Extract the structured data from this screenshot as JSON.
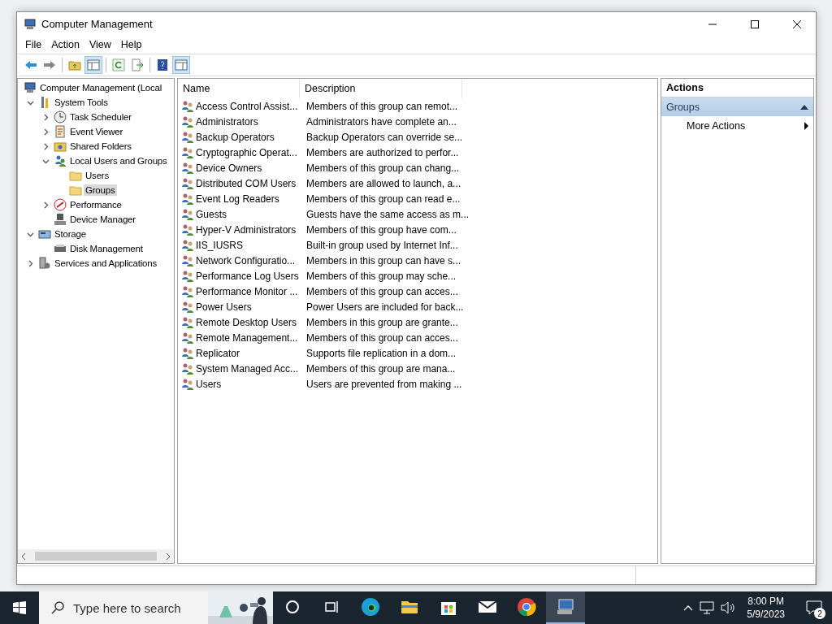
{
  "window": {
    "title": "Computer Management"
  },
  "menu": [
    {
      "label": "File"
    },
    {
      "label": "Action"
    },
    {
      "label": "View"
    },
    {
      "label": "Help"
    }
  ],
  "toolbar": [
    {
      "kind": "back",
      "pressed": false
    },
    {
      "kind": "forward",
      "pressed": false
    },
    {
      "kind": "sep"
    },
    {
      "kind": "up",
      "pressed": false
    },
    {
      "kind": "tree",
      "pressed": true
    },
    {
      "kind": "sep"
    },
    {
      "kind": "refresh",
      "pressed": false
    },
    {
      "kind": "export",
      "pressed": false
    },
    {
      "kind": "sep"
    },
    {
      "kind": "help",
      "pressed": false
    },
    {
      "kind": "actionpane",
      "pressed": true
    }
  ],
  "tree": {
    "label": "Computer Management (Local",
    "kind": "computer",
    "selected": false,
    "children": [
      {
        "label": "System Tools",
        "kind": "tools",
        "selected": false,
        "expanded": true,
        "children": [
          {
            "label": "Task Scheduler",
            "kind": "clock",
            "selected": false,
            "expanded": false
          },
          {
            "label": "Event Viewer",
            "kind": "viewer",
            "selected": false,
            "expanded": false
          },
          {
            "label": "Shared Folders",
            "kind": "share",
            "selected": false,
            "expanded": false
          },
          {
            "label": "Local Users and Groups",
            "kind": "users",
            "selected": false,
            "expanded": true,
            "children": [
              {
                "label": "Users",
                "kind": "folder",
                "selected": false
              },
              {
                "label": "Groups",
                "kind": "folder",
                "selected": true
              }
            ]
          },
          {
            "label": "Performance",
            "kind": "gauge",
            "selected": false,
            "expanded": false
          },
          {
            "label": "Device Manager",
            "kind": "device",
            "selected": false
          }
        ]
      },
      {
        "label": "Storage",
        "kind": "storage",
        "selected": false,
        "expanded": true,
        "children": [
          {
            "label": "Disk Management",
            "kind": "disk",
            "selected": false
          }
        ]
      },
      {
        "label": "Services and Applications",
        "kind": "services",
        "selected": false,
        "expanded": false
      }
    ]
  },
  "table": {
    "columns": [
      "Name",
      "Description"
    ],
    "rows": [
      {
        "name": "Access Control Assist...",
        "description": "Members of this group can remot..."
      },
      {
        "name": "Administrators",
        "description": "Administrators have complete an..."
      },
      {
        "name": "Backup Operators",
        "description": "Backup Operators can override se..."
      },
      {
        "name": "Cryptographic Operat...",
        "description": "Members are authorized to perfor..."
      },
      {
        "name": "Device Owners",
        "description": "Members of this group can chang..."
      },
      {
        "name": "Distributed COM Users",
        "description": "Members are allowed to launch, a..."
      },
      {
        "name": "Event Log Readers",
        "description": "Members of this group can read e..."
      },
      {
        "name": "Guests",
        "description": "Guests have the same access as m..."
      },
      {
        "name": "Hyper-V Administrators",
        "description": "Members of this group have com..."
      },
      {
        "name": "IIS_IUSRS",
        "description": "Built-in group used by Internet Inf..."
      },
      {
        "name": "Network Configuratio...",
        "description": "Members in this group can have s..."
      },
      {
        "name": "Performance Log Users",
        "description": "Members of this group may sche..."
      },
      {
        "name": "Performance Monitor ...",
        "description": "Members of this group can acces..."
      },
      {
        "name": "Power Users",
        "description": "Power Users are included for back..."
      },
      {
        "name": "Remote Desktop Users",
        "description": "Members in this group are grante..."
      },
      {
        "name": "Remote Management...",
        "description": "Members of this group can acces..."
      },
      {
        "name": "Replicator",
        "description": "Supports file replication in a dom..."
      },
      {
        "name": "System Managed Acc...",
        "description": "Members of this group are mana..."
      },
      {
        "name": "Users",
        "description": "Users are prevented from making ..."
      }
    ]
  },
  "actions": {
    "title": "Actions",
    "section": {
      "label": "Groups",
      "expanded": true
    },
    "items": [
      {
        "label": "More Actions"
      }
    ]
  },
  "taskbar": {
    "search": {
      "placeholder": "Type here to search"
    },
    "apps": [
      {
        "kind": "cortana",
        "active": false
      },
      {
        "kind": "taskview",
        "active": false
      },
      {
        "kind": "edge",
        "active": false
      },
      {
        "kind": "explorer",
        "active": false
      },
      {
        "kind": "store",
        "active": false
      },
      {
        "kind": "mail",
        "active": false
      },
      {
        "kind": "chrome",
        "active": false
      },
      {
        "kind": "compmgmt",
        "active": true
      }
    ],
    "time": "8:00 PM",
    "date": "5/9/2023",
    "notifications": "2"
  }
}
